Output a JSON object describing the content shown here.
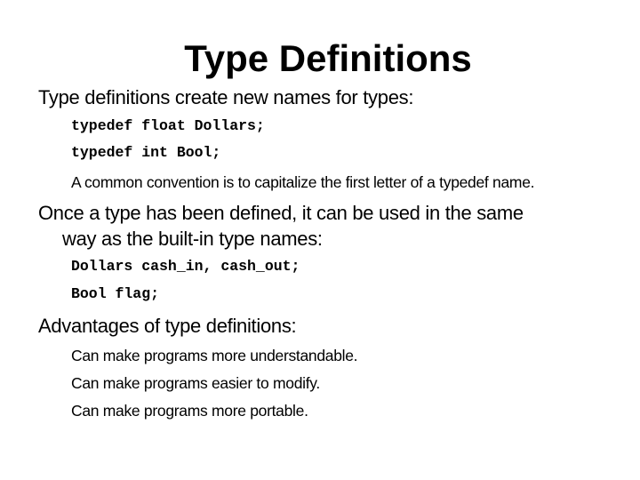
{
  "slide": {
    "title": "Type Definitions",
    "sections": [
      {
        "heading": "Type definitions create new names for types:",
        "code_lines": [
          "typedef float Dollars;",
          "typedef int Bool;"
        ],
        "note": "A common convention is to capitalize the first letter of a typedef name."
      },
      {
        "heading_line1": "Once a type has been defined, it can be used in the same",
        "heading_line2": "way as the built-in type names:",
        "code_lines": [
          "Dollars cash_in, cash_out;",
          "Bool flag;"
        ]
      },
      {
        "heading": "Advantages of type definitions:",
        "bullets": [
          "Can make programs more understandable.",
          "Can make programs easier to modify.",
          "Can make programs more portable."
        ]
      }
    ]
  }
}
